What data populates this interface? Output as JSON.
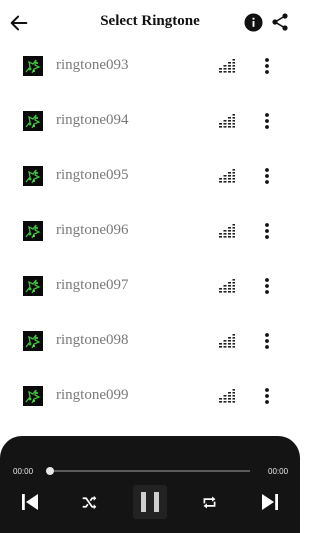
{
  "header": {
    "title": "Select Ringtone",
    "back_icon": "arrow-left-icon",
    "info_icon": "info-icon",
    "share_icon": "share-icon"
  },
  "ringtones": [
    {
      "name": "ringtone093"
    },
    {
      "name": "ringtone094"
    },
    {
      "name": "ringtone095"
    },
    {
      "name": "ringtone096"
    },
    {
      "name": "ringtone097"
    },
    {
      "name": "ringtone098"
    },
    {
      "name": "ringtone099"
    }
  ],
  "player": {
    "current_time": "00:00",
    "total_time": "00:00",
    "progress": 0,
    "state": "playing"
  },
  "colors": {
    "background": "#ffffff",
    "player_background": "#141414",
    "item_text": "#7a7a7a",
    "thumb_accent": "#3cc13c"
  }
}
